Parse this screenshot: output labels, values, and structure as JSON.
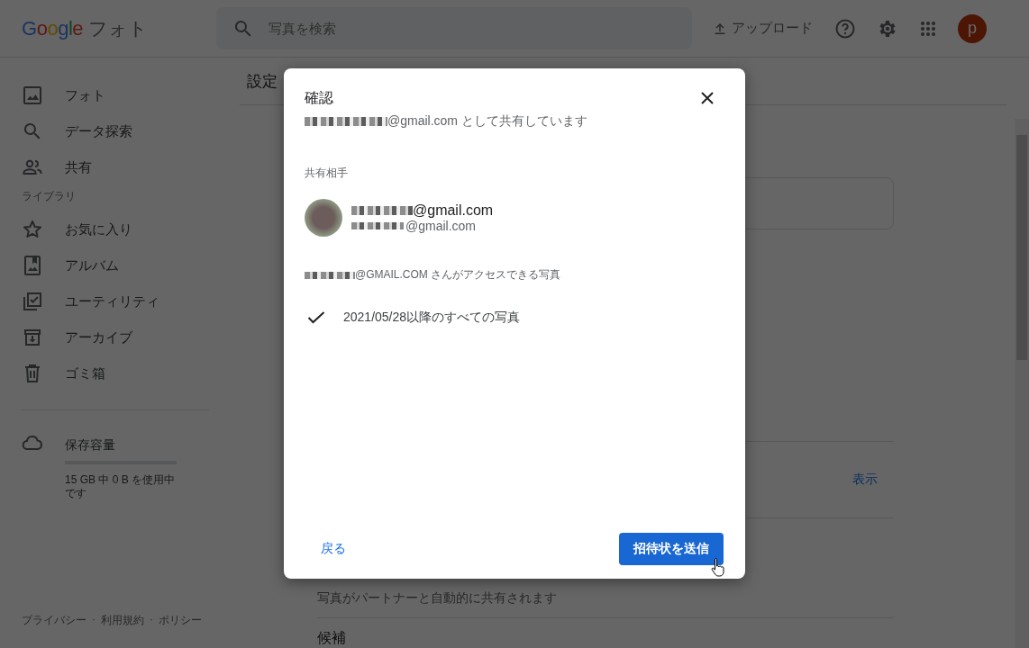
{
  "app": {
    "logo_google": "Google",
    "logo_product": "フォト"
  },
  "search": {
    "placeholder": "写真を検索"
  },
  "header_actions": {
    "upload": "アップロード",
    "avatar_letter": "p"
  },
  "sidebar": {
    "items": [
      {
        "label": "フォト"
      },
      {
        "label": "データ探索"
      },
      {
        "label": "共有"
      }
    ],
    "section_label": "ライブラリ",
    "library_items": [
      {
        "label": "お気に入り"
      },
      {
        "label": "アルバム"
      },
      {
        "label": "ユーティリティ"
      },
      {
        "label": "アーカイブ"
      },
      {
        "label": "ゴミ箱"
      }
    ],
    "storage": {
      "title": "保存容量",
      "level": 0,
      "usage": "15 GB 中 0 B を使用中です"
    },
    "footer": {
      "links": [
        "プライバシー",
        "利用規約",
        "ポリシー"
      ],
      "separator": "·"
    }
  },
  "main": {
    "title": "設定",
    "link": "表示",
    "description": "写真がパートナーと自動的に共有されます",
    "section_heading": "候補"
  },
  "dialog": {
    "title": "確認",
    "sharing_as": "@gmail.com として共有しています",
    "recipients_label": "共有相手",
    "recipient": {
      "name": "@gmail.com",
      "email": "@gmail.com"
    },
    "access_label": "@GMAIL.COM さんがアクセスできる写真",
    "access_items": [
      {
        "label": "2021/05/28以降のすべての写真",
        "checked": true
      }
    ],
    "back_button": "戻る",
    "send_button": "招待状を送信"
  }
}
